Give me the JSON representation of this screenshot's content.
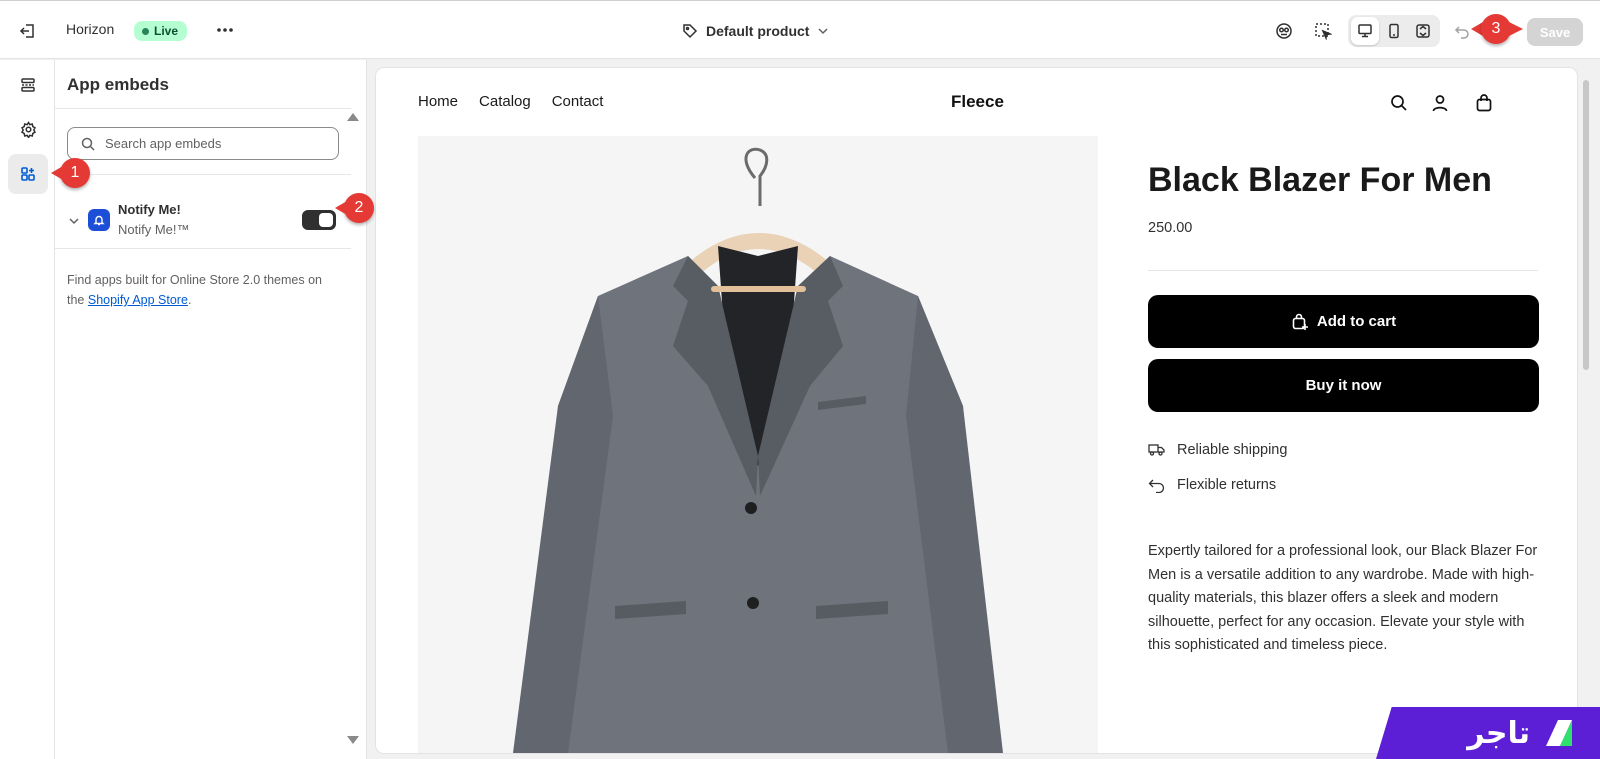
{
  "topbar": {
    "theme_name": "Horizon",
    "live_badge": "Live",
    "template_selector": "Default product",
    "save_label": "Save"
  },
  "sidebar": {
    "title": "App embeds",
    "search_placeholder": "Search app embeds",
    "embed": {
      "name": "Notify Me!",
      "subtitle": "Notify Me!™",
      "enabled": true
    },
    "info_text": "Find apps built for Online Store 2.0 themes on the ",
    "info_link": "Shopify App Store",
    "info_suffix": "."
  },
  "preview": {
    "nav": [
      "Home",
      "Catalog",
      "Contact"
    ],
    "brand": "Fleece",
    "product_title": "Black Blazer For Men",
    "price": "250.00",
    "add_to_cart": "Add to cart",
    "buy_now": "Buy it now",
    "features": [
      "Reliable shipping",
      "Flexible returns"
    ],
    "description": "Expertly tailored for a professional look, our Black Blazer For Men is a versatile addition to any wardrobe. Made with high-quality materials, this blazer offers a sleek and modern silhouette, perfect for any occasion. Elevate your style with this sophisticated and timeless piece."
  },
  "markers": [
    "1",
    "2",
    "3"
  ],
  "logo_text": "تاجر",
  "colors": {
    "accent": "#e53935",
    "live_bg": "#b4fed2",
    "brand_purple": "#5c1fd6",
    "primary_button": "#000000"
  }
}
